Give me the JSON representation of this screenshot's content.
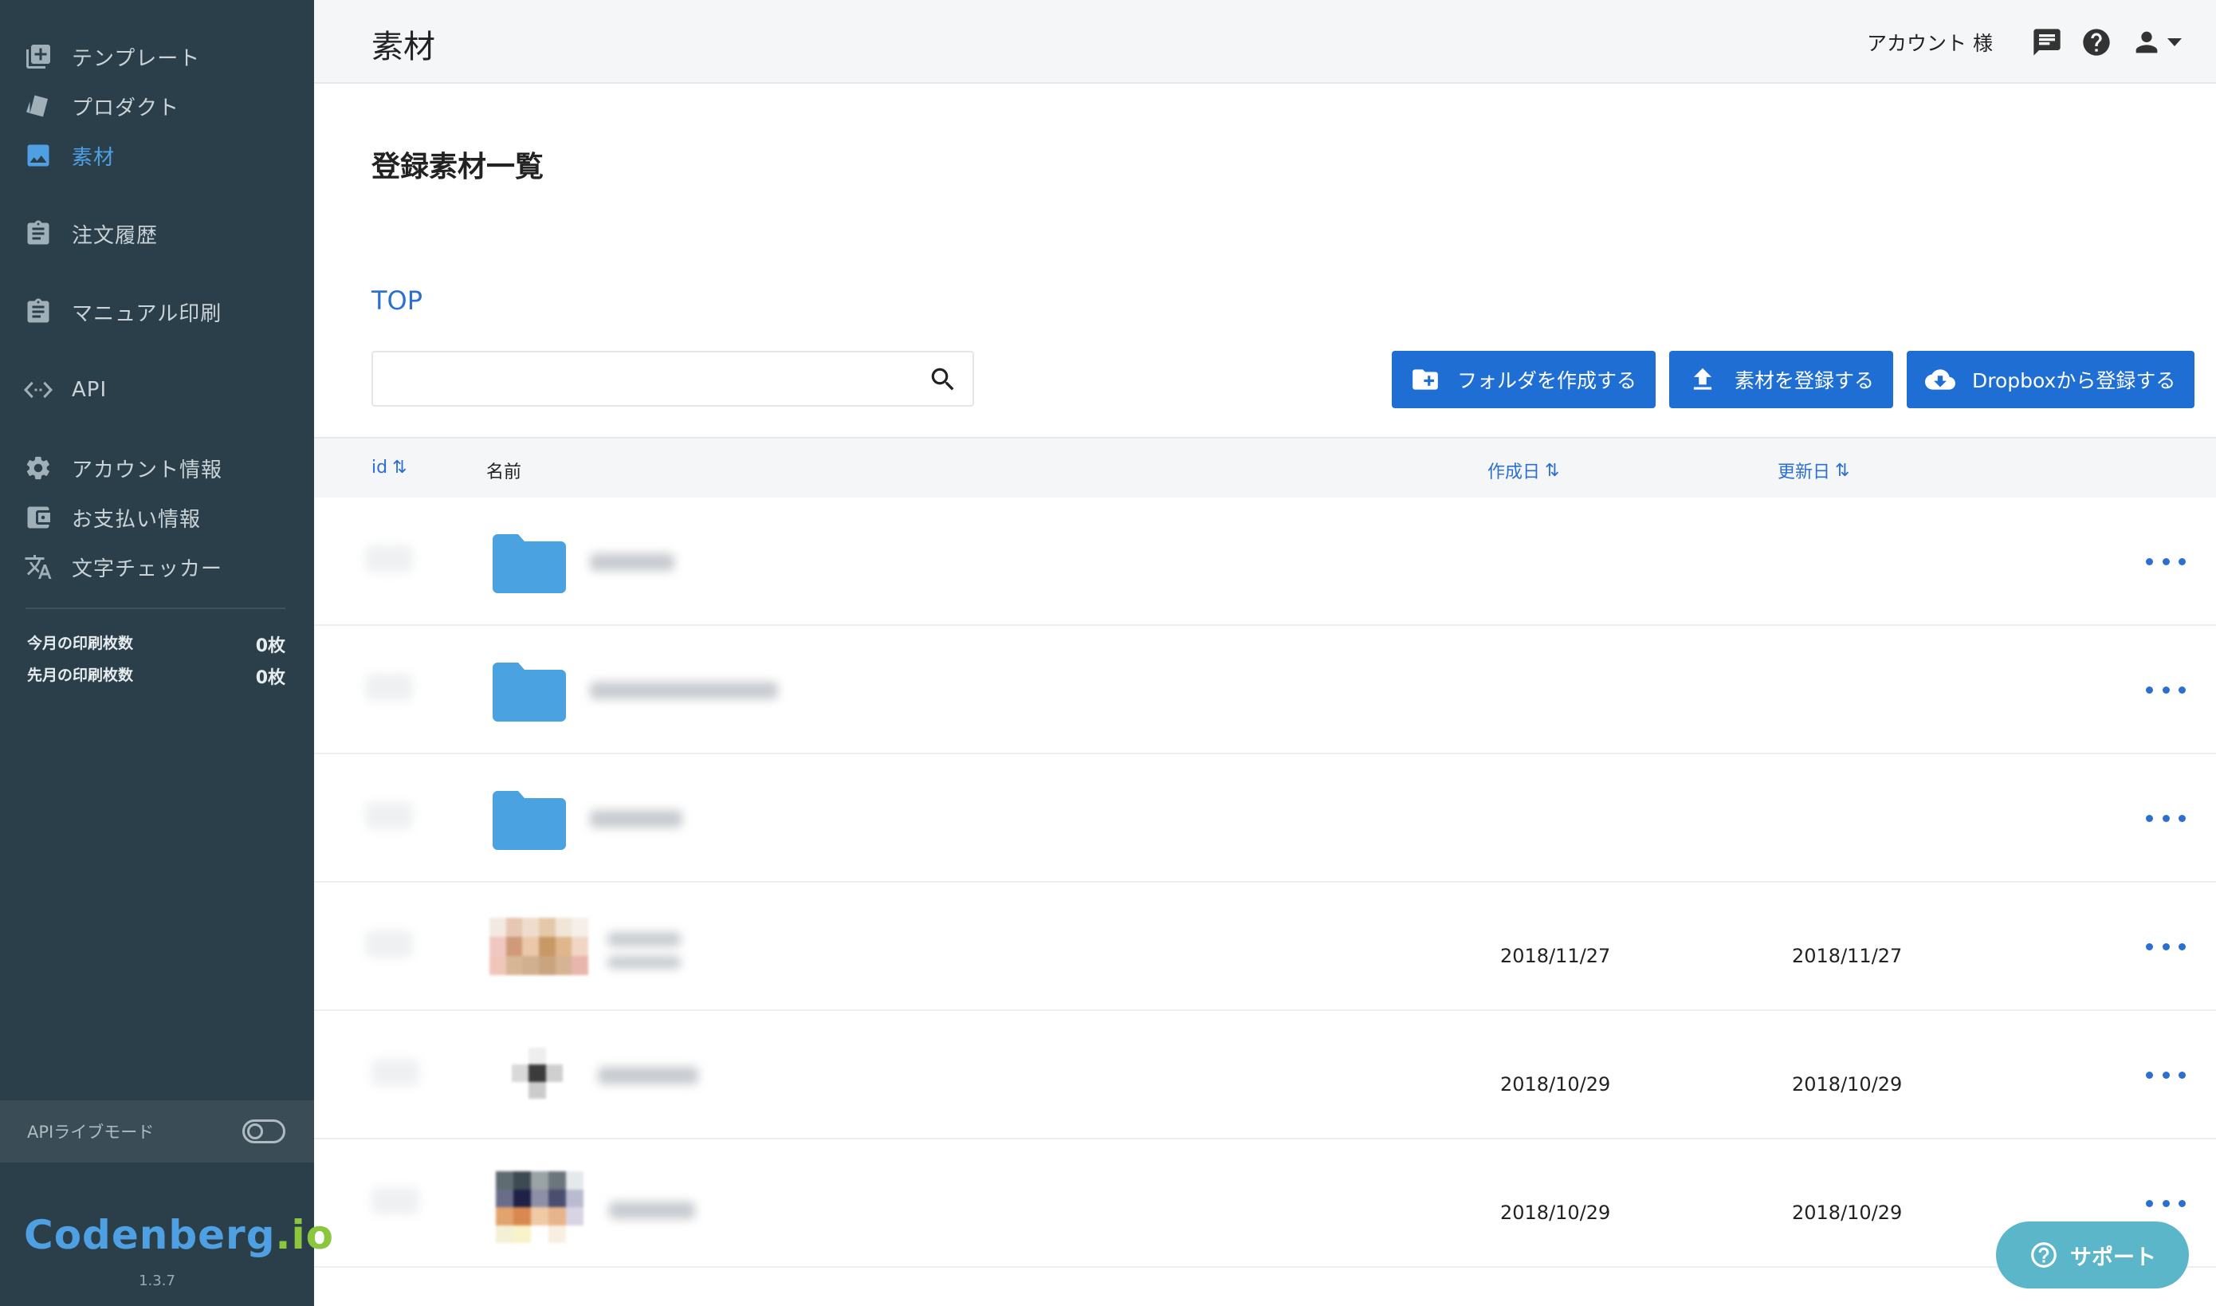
{
  "sidebar": {
    "items": [
      {
        "label": "テンプレート",
        "icon": "add-box-icon"
      },
      {
        "label": "プロダクト",
        "icon": "cards-icon"
      },
      {
        "label": "素材",
        "icon": "image-icon"
      },
      {
        "label": "注文履歴",
        "icon": "clipboard-icon"
      },
      {
        "label": "マニュアル印刷",
        "icon": "clipboard-icon"
      },
      {
        "label": "API",
        "icon": "code-icon"
      },
      {
        "label": "アカウント情報",
        "icon": "gear-icon"
      },
      {
        "label": "お支払い情報",
        "icon": "wallet-icon"
      },
      {
        "label": "文字チェッカー",
        "icon": "translate-icon"
      }
    ],
    "active": "素材",
    "counts": [
      {
        "label": "今月の印刷枚数",
        "value": "0枚"
      },
      {
        "label": "先月の印刷枚数",
        "value": "0枚"
      }
    ],
    "api_mode_label": "APIライブモード",
    "api_mode_on": false,
    "logo_main": "Codenberg",
    "logo_dot": ".io",
    "version": "1.3.7"
  },
  "header": {
    "title": "素材",
    "account": "アカウント 様"
  },
  "main": {
    "section_title": "登録素材一覧",
    "breadcrumb": "TOP",
    "search_placeholder": "",
    "buttons": {
      "create_folder": "フォルダを作成する",
      "register": "素材を登録する",
      "dropbox": "Dropboxから登録する"
    },
    "columns": {
      "id": "id",
      "name": "名前",
      "created": "作成日",
      "updated": "更新日",
      "sort_glyph": "⇅"
    },
    "rows": [
      {
        "type": "folder",
        "created": "",
        "updated": ""
      },
      {
        "type": "folder",
        "created": "",
        "updated": ""
      },
      {
        "type": "folder",
        "created": "",
        "updated": ""
      },
      {
        "type": "image",
        "created": "2018/11/27",
        "updated": "2018/11/27"
      },
      {
        "type": "image",
        "created": "2018/10/29",
        "updated": "2018/10/29"
      },
      {
        "type": "image",
        "created": "2018/10/29",
        "updated": "2018/10/29"
      }
    ]
  },
  "support": {
    "label": "サポート"
  },
  "colors": {
    "sidebar_bg": "#2b3f4a",
    "accent": "#4ea0e3",
    "primary_button": "#1f6ed4",
    "link": "#2c6fd1",
    "folder": "#4aa3e0",
    "support": "#5bb6c9"
  }
}
